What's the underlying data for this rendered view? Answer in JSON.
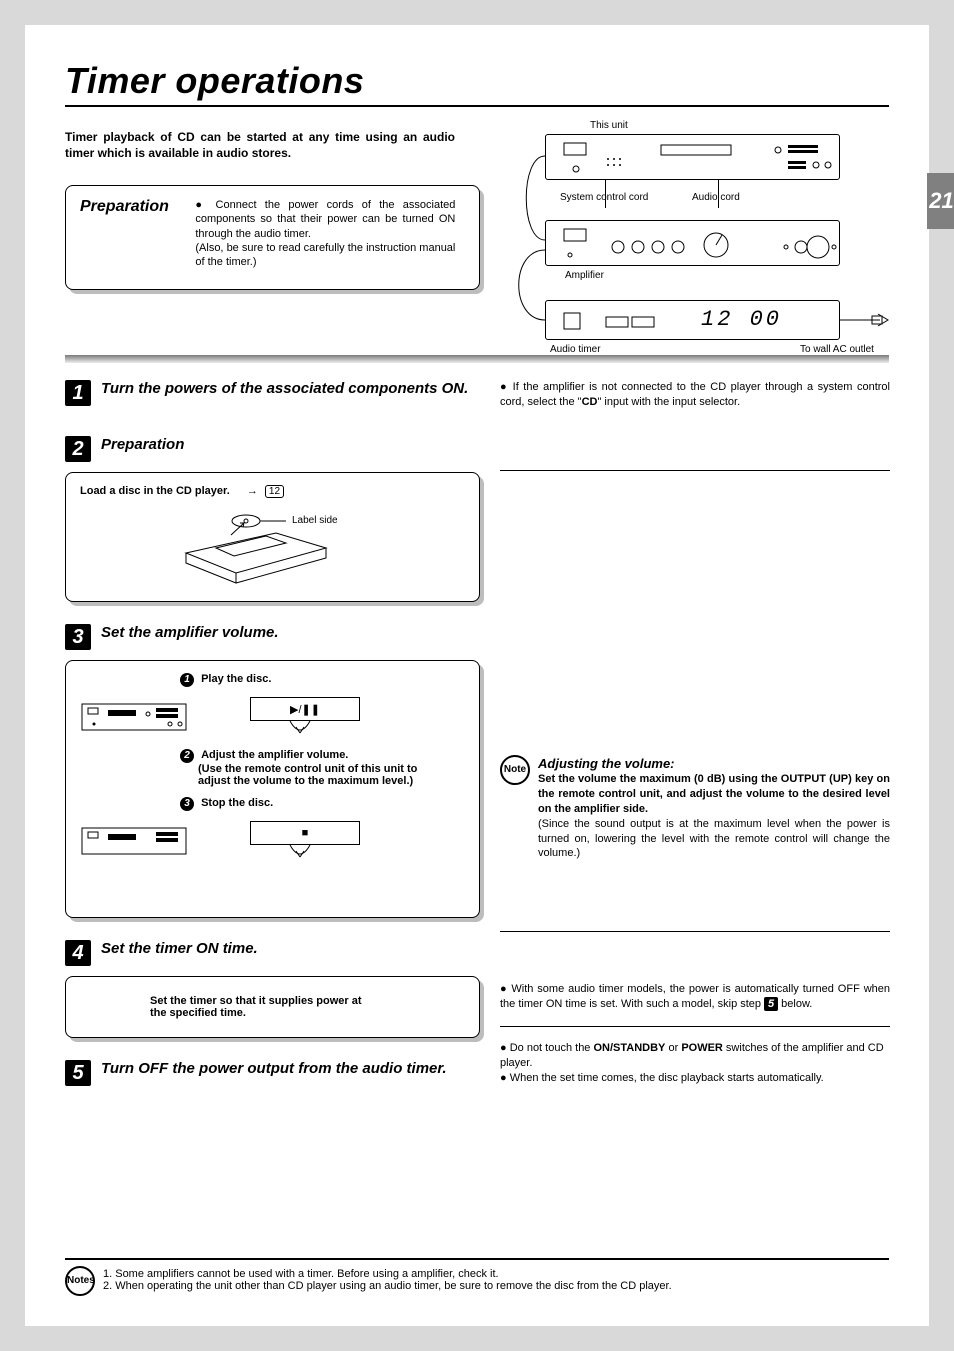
{
  "page_number": "21",
  "title": "Timer operations",
  "intro": "Timer playback of CD can be started at any time using an audio timer which is available in audio stores.",
  "preparation_heading": "Preparation",
  "preparation_bullet": "Connect the power cords of the associated components so that their power can be turned ON through the audio timer.",
  "preparation_paren": "(Also, be sure to read carefully the instruction manual of the timer.)",
  "diagram": {
    "this_unit": "This unit",
    "system_cord": "System control cord",
    "audio_cord": "Audio cord",
    "amplifier": "Amplifier",
    "audio_timer": "Audio timer",
    "wall": "To wall AC outlet",
    "time": "12  00"
  },
  "right_top_bullet_a": "If the amplifier is not connected to the CD player through a system control cord, select the \"",
  "right_top_bold": "CD",
  "right_top_bullet_b": "\" input with the input selector.",
  "steps": {
    "s1": {
      "num": "1",
      "title": "Turn the powers of the associated components ON."
    },
    "s2": {
      "num": "2",
      "title": "Preparation",
      "load": "Load a disc in the CD player.",
      "pageref": "12",
      "label_side": "Label side"
    },
    "s3": {
      "num": "3",
      "title": "Set the amplifier volume.",
      "play_num": "1",
      "play": "Play the disc.",
      "adj_num": "2",
      "adj": "Adjust the amplifier volume.",
      "adj2": "(Use the remote control unit of this unit to adjust the volume to the maximum level.)",
      "stop_num": "3",
      "stop": "Stop the disc."
    },
    "s4": {
      "num": "4",
      "title": "Set the timer ON time.",
      "body": "Set the timer so that it supplies power at the specified time."
    },
    "s5": {
      "num": "5",
      "title": "Turn OFF the power output from the audio timer."
    }
  },
  "adjust_note": {
    "head": "Adjusting the volume:",
    "bold": "Set the volume the maximum (0 dB) using the OUTPUT (UP) key on the remote control unit, and adjust the volume to the desired level on the amplifier side.",
    "body": "(Since the sound output is at the maximum level when the power is turned on, lowering the level with the remote control will change the volume.)"
  },
  "r_bullet4_a": "With some audio timer models, the power is automatically turned OFF when the timer ON time is set. With such a model, skip step ",
  "r_bullet4_step": "5",
  "r_bullet4_b": " below.",
  "r_bullet5a_pre": "Do not touch the ",
  "r_bullet5a_b1": "ON/STANDBY",
  "r_bullet5a_mid": " or ",
  "r_bullet5a_b2": "POWER",
  "r_bullet5a_post": " switches of the amplifier and CD player.",
  "r_bullet5b": "When the set time comes, the disc playback starts automatically.",
  "footnotes": {
    "label": "Notes",
    "n1": "1.   Some amplifiers cannot be used with a timer. Before using a amplifier, check it.",
    "n2": "2.   When operating the unit other than CD player using an audio timer, be sure to remove the disc from the CD player."
  },
  "icons": {
    "note": "Note",
    "notes": "Notes"
  }
}
